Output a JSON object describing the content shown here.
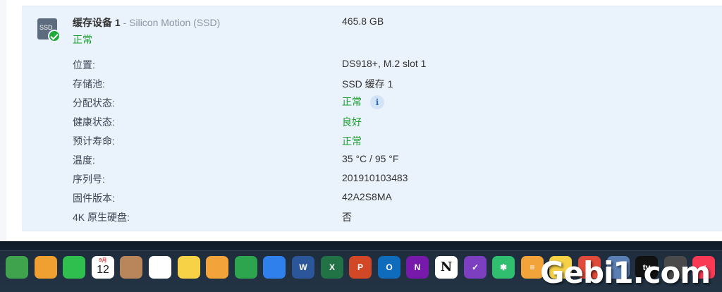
{
  "device": {
    "icon_label": "SSD",
    "name": "缓存设备 1",
    "vendor": " - Silicon Motion (SSD)",
    "status": "正常",
    "size": "465.8 GB",
    "rows": [
      {
        "label": "位置:",
        "value": "DS918+, M.2 slot 1"
      },
      {
        "label": "存储池:",
        "value": "SSD 缓存 1"
      },
      {
        "label": "分配状态:",
        "value": "正常"
      },
      {
        "label": "健康状态:",
        "value": "良好"
      },
      {
        "label": "预计寿命:",
        "value": "正常"
      },
      {
        "label": "温度:",
        "value": "35 °C / 95 °F"
      },
      {
        "label": "序列号:",
        "value": "201910103483"
      },
      {
        "label": "固件版本:",
        "value": "42A2S8MA"
      },
      {
        "label": "4K 原生硬盘:",
        "value": "否"
      }
    ],
    "info_glyph": "i"
  },
  "dock": {
    "calendar_month": "9月",
    "calendar_day": "12",
    "apps": [
      {
        "name": "maps-icon",
        "color": "#3fa34d",
        "glyph": ""
      },
      {
        "name": "photos-icon",
        "color": "#f0a030",
        "glyph": ""
      },
      {
        "name": "facetime-icon",
        "color": "#2fbf4f",
        "glyph": ""
      },
      {
        "name": "calendar-icon",
        "color": "#ffffff",
        "glyph": ""
      },
      {
        "name": "contacts-icon",
        "color": "#b8865a",
        "glyph": ""
      },
      {
        "name": "reminders-icon",
        "color": "#ffffff",
        "glyph": ""
      },
      {
        "name": "notes-icon",
        "color": "#f7d146",
        "glyph": ""
      },
      {
        "name": "pages-icon",
        "color": "#f2a33a",
        "glyph": ""
      },
      {
        "name": "numbers-icon",
        "color": "#2da44e",
        "glyph": ""
      },
      {
        "name": "keynote-icon",
        "color": "#2f80ed",
        "glyph": ""
      },
      {
        "name": "word-icon",
        "color": "#2b579a",
        "glyph": "W"
      },
      {
        "name": "excel-icon",
        "color": "#217346",
        "glyph": "X"
      },
      {
        "name": "powerpoint-icon",
        "color": "#d24726",
        "glyph": "P"
      },
      {
        "name": "outlook-icon",
        "color": "#0f6cbd",
        "glyph": "O"
      },
      {
        "name": "onenote-icon",
        "color": "#7719aa",
        "glyph": "N"
      },
      {
        "name": "notion-icon",
        "color": "#ffffff",
        "glyph": "N"
      },
      {
        "name": "omnifocus-icon",
        "color": "#7b3fbf",
        "glyph": "✓"
      },
      {
        "name": "mindnode-icon",
        "color": "#2fbf6f",
        "glyph": "✱"
      },
      {
        "name": "taskpaper-icon",
        "color": "#f2a33a",
        "glyph": "≡"
      },
      {
        "name": "stickies-icon",
        "color": "#f7d146",
        "glyph": ""
      },
      {
        "name": "app-icon",
        "color": "#e04a3a",
        "glyph": ""
      },
      {
        "name": "app-icon-2",
        "color": "#5a7fb5",
        "glyph": ""
      },
      {
        "name": "appletv-icon",
        "color": "#111111",
        "glyph": "tv"
      },
      {
        "name": "app-icon-3",
        "color": "#4a4a4a",
        "glyph": ""
      },
      {
        "name": "music-icon",
        "color": "#fa3a55",
        "glyph": "♫"
      }
    ]
  },
  "watermark": "Gebi1.com"
}
